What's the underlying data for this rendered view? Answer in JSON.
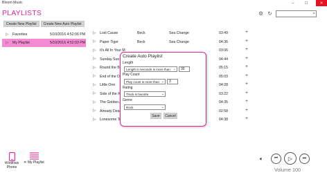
{
  "app": {
    "title": "Bloom Music"
  },
  "window_controls": {
    "minimize": "–",
    "maximize": "☐",
    "close": "✕"
  },
  "page": {
    "title": "PLAYLISTS"
  },
  "search": {
    "placeholder": "",
    "value": ""
  },
  "toolbar": {
    "create_playlist": "Create New Playlist",
    "create_auto_playlist": "Create New Auto Playlist"
  },
  "playlists": [
    {
      "name": "Favorites",
      "date": "5/10/2016 4:52:06 PM",
      "selected": false
    },
    {
      "name": "My Playlist",
      "date": "5/10/2016 4:52:03 PM",
      "selected": true
    }
  ],
  "songs": [
    {
      "title": "Lost Cause",
      "artist": "Beck",
      "album": "Sea Change",
      "duration": "03:49"
    },
    {
      "title": "Paper Tiger",
      "artist": "Beck",
      "album": "Sea Change",
      "duration": "04:36"
    },
    {
      "title": "It's All In Your M",
      "artist": "",
      "album": "",
      "duration": "03:06"
    },
    {
      "title": "Sunday Sun",
      "artist": "",
      "album": "",
      "duration": "04:44"
    },
    {
      "title": "Round the Bend",
      "artist": "",
      "album": "",
      "duration": "05:15"
    },
    {
      "title": "End of the Day",
      "artist": "",
      "album": "",
      "duration": "05:03"
    },
    {
      "title": "Little One",
      "artist": "",
      "album": "",
      "duration": "04:28"
    },
    {
      "title": "Side of the Road",
      "artist": "",
      "album": "",
      "duration": "03:22"
    },
    {
      "title": "The Golden Age",
      "artist": "",
      "album": "",
      "duration": "04:35"
    },
    {
      "title": "Already Dead",
      "artist": "Beck",
      "album": "Sea Change",
      "duration": "02:58"
    },
    {
      "title": "Lonesome Tears",
      "artist": "Beck",
      "album": "Sea Change",
      "duration": "04:38"
    }
  ],
  "dialog": {
    "title": "Create Auto Playlist",
    "length_label": "Length",
    "length_option": "Length in seconds is more than",
    "length_value": "30",
    "playcount_label": "Play Count",
    "playcount_option": "Play count is more than",
    "playcount_value": "3",
    "rating_label": "Rating",
    "rating_option": "Track is favorite",
    "genre_label": "Genre",
    "genre_option": "Rock",
    "save": "Save",
    "cancel": "Cancel"
  },
  "bottom_nav": {
    "phone_label": "Windows Phone",
    "playlist_label": "My Playlist"
  },
  "player": {
    "volume_label": "Volume 100"
  },
  "icons": {
    "gear": "⚙",
    "refresh": "↻",
    "search": "⌕",
    "play": "▷",
    "add": "+",
    "prev": "⏮",
    "play_big": "▷",
    "next": "⏭",
    "volume": "🔈︎",
    "caret": "⌄"
  },
  "colors": {
    "accent": "#e0249a",
    "selected_row": "#f58bd3",
    "close": "#e81123"
  }
}
